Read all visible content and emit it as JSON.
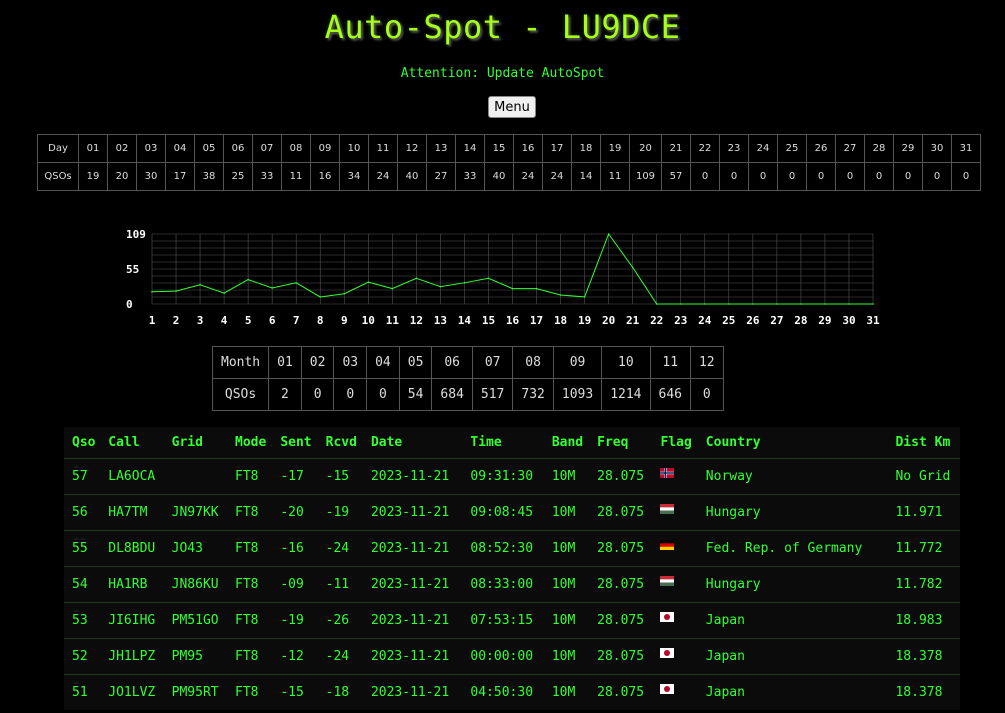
{
  "header": {
    "title": "Auto-Spot - LU9DCE",
    "attention": "Attention: Update AutoSpot",
    "menu_label": "Menu"
  },
  "days_table": {
    "day_label": "Day",
    "qsos_label": "QSOs",
    "days": [
      "01",
      "02",
      "03",
      "04",
      "05",
      "06",
      "07",
      "08",
      "09",
      "10",
      "11",
      "12",
      "13",
      "14",
      "15",
      "16",
      "17",
      "18",
      "19",
      "20",
      "21",
      "22",
      "23",
      "24",
      "25",
      "26",
      "27",
      "28",
      "29",
      "30",
      "31"
    ],
    "counts": [
      "19",
      "20",
      "30",
      "17",
      "38",
      "25",
      "33",
      "11",
      "16",
      "34",
      "24",
      "40",
      "27",
      "33",
      "40",
      "24",
      "24",
      "14",
      "11",
      "109",
      "57",
      "0",
      "0",
      "0",
      "0",
      "0",
      "0",
      "0",
      "0",
      "0",
      "0"
    ]
  },
  "chart_data": {
    "type": "line",
    "x": [
      1,
      2,
      3,
      4,
      5,
      6,
      7,
      8,
      9,
      10,
      11,
      12,
      13,
      14,
      15,
      16,
      17,
      18,
      19,
      20,
      21,
      22,
      23,
      24,
      25,
      26,
      27,
      28,
      29,
      30,
      31
    ],
    "y": [
      19,
      20,
      30,
      17,
      38,
      25,
      33,
      11,
      16,
      34,
      24,
      40,
      27,
      33,
      40,
      24,
      24,
      14,
      11,
      109,
      57,
      0,
      0,
      0,
      0,
      0,
      0,
      0,
      0,
      0,
      0
    ],
    "y_ticks": [
      "109",
      "55",
      "0"
    ],
    "x_ticks": [
      "1",
      "2",
      "3",
      "4",
      "5",
      "6",
      "7",
      "8",
      "9",
      "10",
      "11",
      "12",
      "13",
      "14",
      "15",
      "16",
      "17",
      "18",
      "19",
      "20",
      "21",
      "22",
      "23",
      "24",
      "25",
      "26",
      "27",
      "28",
      "29",
      "30",
      "31"
    ],
    "ylim": [
      0,
      109
    ],
    "grid": true,
    "line_color": "#33ff33",
    "grid_color": "#555555"
  },
  "months_table": {
    "month_label": "Month",
    "qsos_label": "QSOs",
    "months": [
      "01",
      "02",
      "03",
      "04",
      "05",
      "06",
      "07",
      "08",
      "09",
      "10",
      "11",
      "12"
    ],
    "counts": [
      "2",
      "0",
      "0",
      "0",
      "54",
      "684",
      "517",
      "732",
      "1093",
      "1214",
      "646",
      "0"
    ]
  },
  "qso_table": {
    "columns": [
      "Qso",
      "Call",
      "Grid",
      "Mode",
      "Sent",
      "Rcvd",
      "Date",
      "Time",
      "Band",
      "Freq",
      "Flag",
      "Country",
      "Dist Km"
    ],
    "rows": [
      {
        "qso": "57",
        "call": "LA6OCA",
        "grid": "",
        "mode": "FT8",
        "sent": "-17",
        "rcvd": "-15",
        "date": "2023-11-21",
        "time": "09:31:30",
        "band": "10M",
        "freq": "28.075",
        "flag": "norway-flag",
        "country": "Norway",
        "dist": "No Grid"
      },
      {
        "qso": "56",
        "call": "HA7TM",
        "grid": "JN97KK",
        "mode": "FT8",
        "sent": "-20",
        "rcvd": "-19",
        "date": "2023-11-21",
        "time": "09:08:45",
        "band": "10M",
        "freq": "28.075",
        "flag": "hungary-flag",
        "country": "Hungary",
        "dist": "11.971"
      },
      {
        "qso": "55",
        "call": "DL8BDU",
        "grid": "JO43",
        "mode": "FT8",
        "sent": "-16",
        "rcvd": "-24",
        "date": "2023-11-21",
        "time": "08:52:30",
        "band": "10M",
        "freq": "28.075",
        "flag": "germany-flag",
        "country": "Fed. Rep. of Germany",
        "dist": "11.772"
      },
      {
        "qso": "54",
        "call": "HA1RB",
        "grid": "JN86KU",
        "mode": "FT8",
        "sent": "-09",
        "rcvd": "-11",
        "date": "2023-11-21",
        "time": "08:33:00",
        "band": "10M",
        "freq": "28.075",
        "flag": "hungary-flag",
        "country": "Hungary",
        "dist": "11.782"
      },
      {
        "qso": "53",
        "call": "JI6IHG",
        "grid": "PM51GO",
        "mode": "FT8",
        "sent": "-19",
        "rcvd": "-26",
        "date": "2023-11-21",
        "time": "07:53:15",
        "band": "10M",
        "freq": "28.075",
        "flag": "japan-flag",
        "country": "Japan",
        "dist": "18.983"
      },
      {
        "qso": "52",
        "call": "JH1LPZ",
        "grid": "PM95",
        "mode": "FT8",
        "sent": "-12",
        "rcvd": "-24",
        "date": "2023-11-21",
        "time": "00:00:00",
        "band": "10M",
        "freq": "28.075",
        "flag": "japan-flag",
        "country": "Japan",
        "dist": "18.378"
      },
      {
        "qso": "51",
        "call": "JO1LVZ",
        "grid": "PM95RT",
        "mode": "FT8",
        "sent": "-15",
        "rcvd": "-18",
        "date": "2023-11-21",
        "time": "04:50:30",
        "band": "10M",
        "freq": "28.075",
        "flag": "japan-flag",
        "country": "Japan",
        "dist": "18.378"
      }
    ]
  }
}
